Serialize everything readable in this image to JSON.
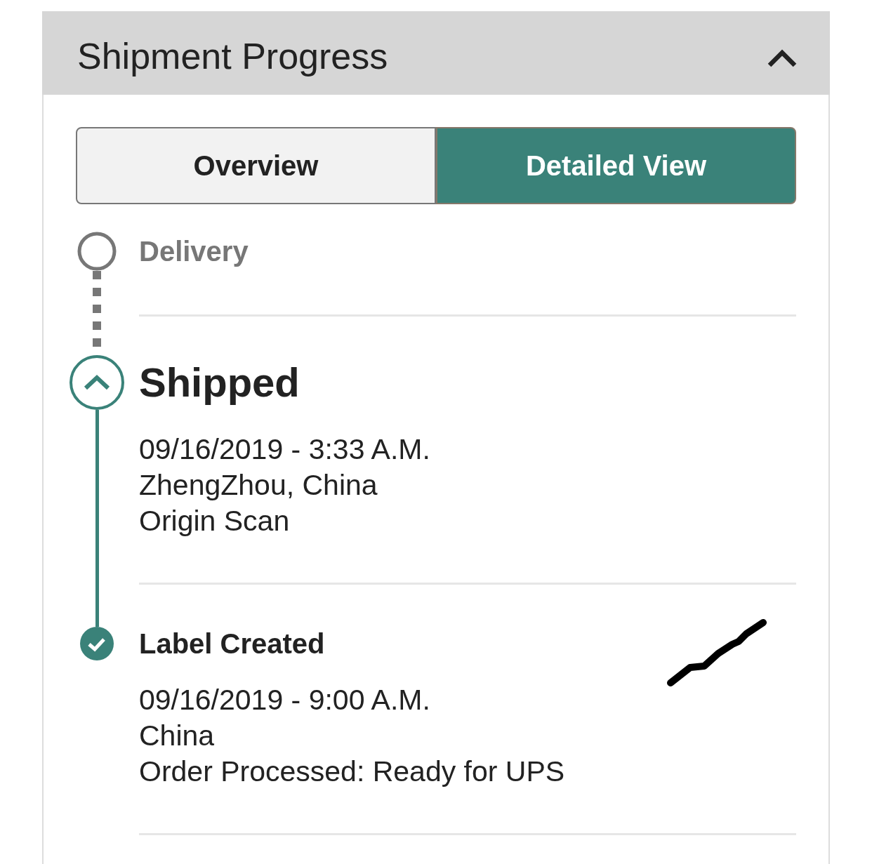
{
  "panel": {
    "title": "Shipment Progress",
    "expanded": true
  },
  "tabs": [
    {
      "label": "Overview",
      "selected": false
    },
    {
      "label": "Detailed View",
      "selected": true
    }
  ],
  "events": [
    {
      "kind": "pending",
      "title": "Delivery",
      "scribbled": false
    },
    {
      "kind": "current",
      "title": "Shipped",
      "date_time": "09/16/2019 - 3:33 A.M.",
      "location": "ZhengZhou, China",
      "activity": "Origin Scan",
      "scribbled": false
    },
    {
      "kind": "done",
      "title": "Label Created",
      "date_time": "09/16/2019 - 9:00 A.M.",
      "location": "China",
      "activity": "Order Processed: Ready for UPS",
      "scribbled": true
    }
  ]
}
